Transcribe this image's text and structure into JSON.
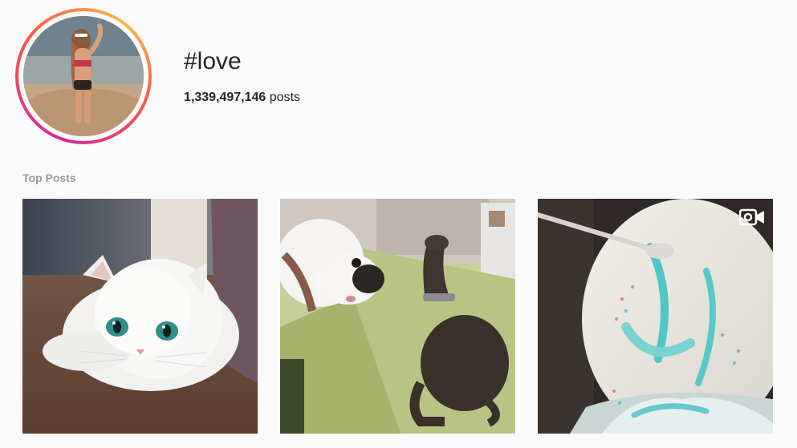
{
  "hashtag": {
    "name": "#love",
    "post_count": "1,339,497,146",
    "post_count_suffix": "posts"
  },
  "avatar": {
    "description": "woman-on-beach-photo"
  },
  "top_posts": {
    "label": "Top Posts",
    "items": [
      {
        "subject": "white-persian-cat",
        "is_video": false
      },
      {
        "subject": "two-dogs-on-couch",
        "is_video": false
      },
      {
        "subject": "frosting-being-stirred",
        "is_video": true
      }
    ]
  },
  "colors": {
    "background": "#fafafa",
    "text": "#262626",
    "muted": "#999999",
    "ring_start": "#d6249f",
    "ring_end": "#fdb849"
  },
  "icons": {
    "video": "video-camera-icon"
  }
}
